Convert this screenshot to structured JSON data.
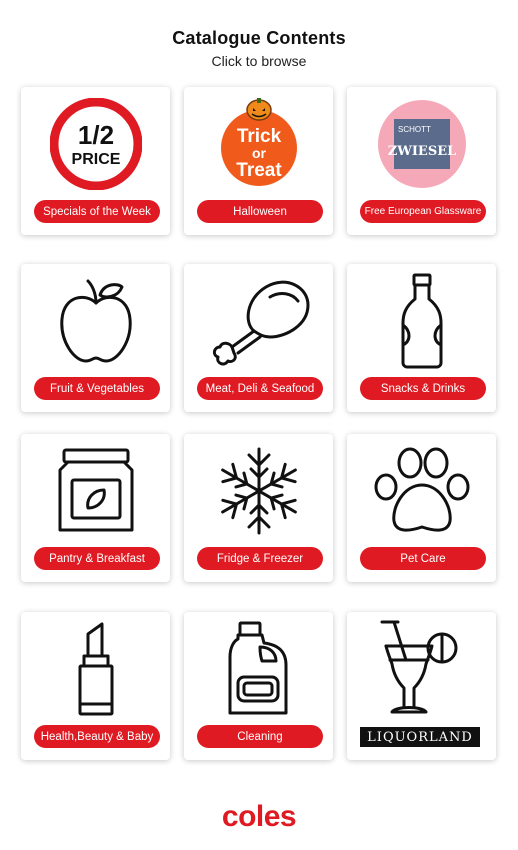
{
  "header": {
    "title": "Catalogue Contents",
    "subtitle": "Click to browse"
  },
  "cards": {
    "specials": {
      "label": "Specials of the Week",
      "badge_line1": "1/2",
      "badge_line2": "PRICE"
    },
    "halloween": {
      "label": "Halloween",
      "badge_line1": "Trick",
      "badge_line2": "or",
      "badge_line3": "Treat"
    },
    "glassware": {
      "label": "Free European Glassware",
      "brand_small": "SCHOTT",
      "brand_big": "ZWIESEL"
    },
    "fruit": {
      "label": "Fruit & Vegetables"
    },
    "meat": {
      "label": "Meat, Deli & Seafood"
    },
    "snacks": {
      "label": "Snacks & Drinks"
    },
    "pantry": {
      "label": "Pantry & Breakfast"
    },
    "fridge": {
      "label": "Fridge & Freezer"
    },
    "pet": {
      "label": "Pet Care"
    },
    "health": {
      "label": "Health,Beauty & Baby"
    },
    "cleaning": {
      "label": "Cleaning"
    },
    "liquor": {
      "label": "LIQUORLAND"
    }
  },
  "footer": {
    "logo": "coles"
  },
  "colors": {
    "accent": "#e01a22",
    "halloween_orange": "#f05a1a",
    "glassware_pink": "#f5a9b8",
    "glassware_slate": "#5a6b8c"
  }
}
